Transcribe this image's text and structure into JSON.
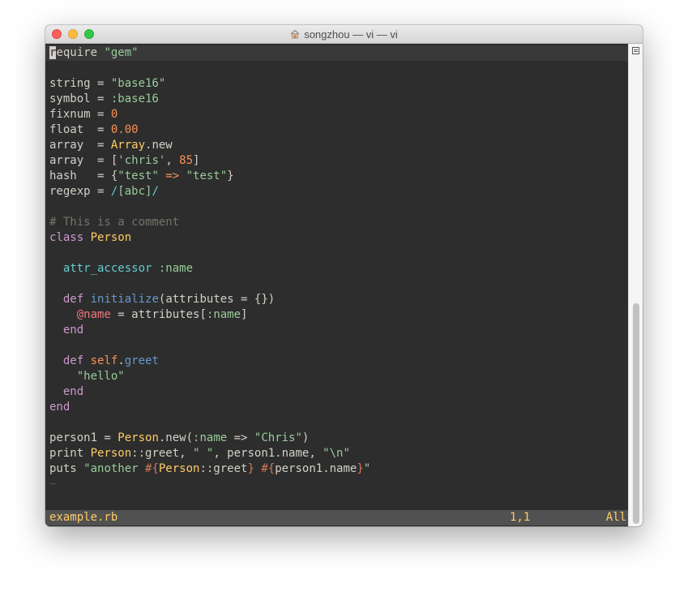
{
  "window": {
    "title": "songzhou — vi — vi"
  },
  "code": [
    {
      "segments": [
        {
          "t": "r",
          "c": "cursor"
        },
        {
          "t": "equire ",
          "c": "t-plain"
        },
        {
          "t": "\"gem\"",
          "c": "t-str"
        }
      ],
      "current": true
    },
    {
      "segments": []
    },
    {
      "segments": [
        {
          "t": "string = ",
          "c": "t-plain"
        },
        {
          "t": "\"base16\"",
          "c": "t-str"
        }
      ]
    },
    {
      "segments": [
        {
          "t": "symbol = ",
          "c": "t-plain"
        },
        {
          "t": ":base16",
          "c": "t-sym"
        }
      ]
    },
    {
      "segments": [
        {
          "t": "fixnum = ",
          "c": "t-plain"
        },
        {
          "t": "0",
          "c": "t-num"
        }
      ]
    },
    {
      "segments": [
        {
          "t": "float  = ",
          "c": "t-plain"
        },
        {
          "t": "0.00",
          "c": "t-num"
        }
      ]
    },
    {
      "segments": [
        {
          "t": "array  = ",
          "c": "t-plain"
        },
        {
          "t": "Array",
          "c": "t-const"
        },
        {
          "t": ".new",
          "c": "t-plain"
        }
      ]
    },
    {
      "segments": [
        {
          "t": "array  = [",
          "c": "t-plain"
        },
        {
          "t": "'chris'",
          "c": "t-str"
        },
        {
          "t": ", ",
          "c": "t-plain"
        },
        {
          "t": "85",
          "c": "t-num"
        },
        {
          "t": "]",
          "c": "t-plain"
        }
      ]
    },
    {
      "segments": [
        {
          "t": "hash   = {",
          "c": "t-plain"
        },
        {
          "t": "\"test\"",
          "c": "t-str"
        },
        {
          "t": " => ",
          "c": "t-num"
        },
        {
          "t": "\"test\"",
          "c": "t-str"
        },
        {
          "t": "}",
          "c": "t-plain"
        }
      ]
    },
    {
      "segments": [
        {
          "t": "regexp = ",
          "c": "t-plain"
        },
        {
          "t": "/",
          "c": "t-op"
        },
        {
          "t": "[abc]",
          "c": "t-str"
        },
        {
          "t": "/",
          "c": "t-op"
        }
      ]
    },
    {
      "segments": []
    },
    {
      "segments": [
        {
          "t": "# This is a comment",
          "c": "t-comment"
        }
      ]
    },
    {
      "segments": [
        {
          "t": "class ",
          "c": "t-kw"
        },
        {
          "t": "Person",
          "c": "t-const"
        }
      ]
    },
    {
      "segments": []
    },
    {
      "segments": [
        {
          "t": "  ",
          "c": "t-plain"
        },
        {
          "t": "attr_accessor",
          "c": "t-op"
        },
        {
          "t": " ",
          "c": "t-plain"
        },
        {
          "t": ":name",
          "c": "t-sym"
        }
      ]
    },
    {
      "segments": []
    },
    {
      "segments": [
        {
          "t": "  ",
          "c": "t-plain"
        },
        {
          "t": "def",
          "c": "t-kw"
        },
        {
          "t": " ",
          "c": "t-plain"
        },
        {
          "t": "initialize",
          "c": "t-fn"
        },
        {
          "t": "(attributes = {})",
          "c": "t-plain"
        }
      ]
    },
    {
      "segments": [
        {
          "t": "    ",
          "c": "t-plain"
        },
        {
          "t": "@name",
          "c": "t-ivar"
        },
        {
          "t": " = attributes[",
          "c": "t-plain"
        },
        {
          "t": ":name",
          "c": "t-sym"
        },
        {
          "t": "]",
          "c": "t-plain"
        }
      ]
    },
    {
      "segments": [
        {
          "t": "  ",
          "c": "t-plain"
        },
        {
          "t": "end",
          "c": "t-kw"
        }
      ]
    },
    {
      "segments": []
    },
    {
      "segments": [
        {
          "t": "  ",
          "c": "t-plain"
        },
        {
          "t": "def",
          "c": "t-kw"
        },
        {
          "t": " ",
          "c": "t-plain"
        },
        {
          "t": "self",
          "c": "t-num"
        },
        {
          "t": ".",
          "c": "t-plain"
        },
        {
          "t": "greet",
          "c": "t-fn"
        }
      ]
    },
    {
      "segments": [
        {
          "t": "    ",
          "c": "t-plain"
        },
        {
          "t": "\"hello\"",
          "c": "t-str"
        }
      ]
    },
    {
      "segments": [
        {
          "t": "  ",
          "c": "t-plain"
        },
        {
          "t": "end",
          "c": "t-kw"
        }
      ]
    },
    {
      "segments": [
        {
          "t": "end",
          "c": "t-kw"
        }
      ]
    },
    {
      "segments": []
    },
    {
      "segments": [
        {
          "t": "person1 = ",
          "c": "t-plain"
        },
        {
          "t": "Person",
          "c": "t-const"
        },
        {
          "t": ".new(",
          "c": "t-plain"
        },
        {
          "t": ":name",
          "c": "t-sym"
        },
        {
          "t": " => ",
          "c": "t-plain"
        },
        {
          "t": "\"Chris\"",
          "c": "t-str"
        },
        {
          "t": ")",
          "c": "t-plain"
        }
      ]
    },
    {
      "segments": [
        {
          "t": "print ",
          "c": "t-plain"
        },
        {
          "t": "Person",
          "c": "t-const"
        },
        {
          "t": "::greet, ",
          "c": "t-plain"
        },
        {
          "t": "\" \"",
          "c": "t-str"
        },
        {
          "t": ", person1.name, ",
          "c": "t-plain"
        },
        {
          "t": "\"\\n\"",
          "c": "t-str"
        }
      ]
    },
    {
      "segments": [
        {
          "t": "puts ",
          "c": "t-plain"
        },
        {
          "t": "\"another ",
          "c": "t-str"
        },
        {
          "t": "#{",
          "c": "t-interp"
        },
        {
          "t": "Person",
          "c": "t-const"
        },
        {
          "t": "::greet",
          "c": "t-plain"
        },
        {
          "t": "}",
          "c": "t-interp"
        },
        {
          "t": " ",
          "c": "t-str"
        },
        {
          "t": "#{",
          "c": "t-interp"
        },
        {
          "t": "person1.name",
          "c": "t-plain"
        },
        {
          "t": "}",
          "c": "t-interp"
        },
        {
          "t": "\"",
          "c": "t-str"
        }
      ]
    },
    {
      "segments": [
        {
          "t": "~",
          "c": "t-tilde"
        }
      ]
    }
  ],
  "status": {
    "filename": "example.rb",
    "position": "1,1",
    "scroll": "All"
  },
  "colors": {
    "background": "#2d2d2d",
    "foreground": "#d3d0c8",
    "string": "#99cc99",
    "number": "#f99157",
    "constant": "#ffcc66",
    "keyword": "#cc99cc",
    "function": "#6699cc",
    "comment": "#747369",
    "status_bg": "#515151"
  },
  "icons": {
    "title": "home-folder-icon",
    "scroll": "split-icon"
  }
}
